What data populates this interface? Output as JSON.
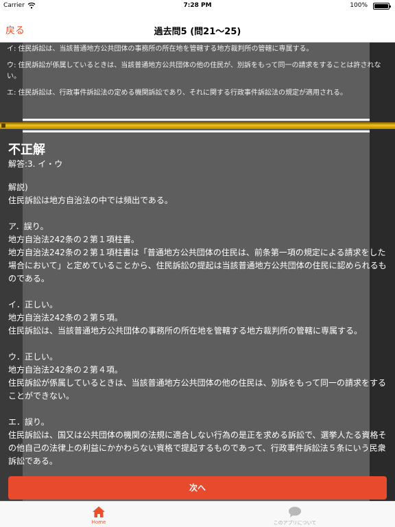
{
  "status": {
    "carrier": "Carrier",
    "time": "7:28 PM",
    "battery": "100%"
  },
  "nav": {
    "back": "戻る",
    "title": "過去問5 (問21〜25)"
  },
  "previous_choices": [
    "イ: 住民訴訟は、当該普通地方公共団体の事務所の所在地を管轄する地方裁判所の管轄に専属する。",
    "ウ: 住民訴訟が係属しているときは、当該普通地方公共団体の他の住民が、別訴をもって同一の請求をすることは許されない。",
    "エ: 住民訴訟は、行政事件訴訟法の定める機関訴訟であり、それに関する行政事件訴訟法の規定が適用される。"
  ],
  "result": {
    "status": "不正解",
    "answer": "解答:3. イ・ウ"
  },
  "explanation": [
    "解説)",
    "住民訴訟は地方自治法の中では頻出である。",
    "",
    "ア．誤り。",
    "地方自治法242条の２第１項柱書。",
    "地方自治法242条の２第１項柱書は「普通地方公共団体の住民は、前条第一項の規定による請求をした場合において」と定めていることから、住民訴訟の提起は当該普通地方公共団体の住民に認められるものである。",
    "",
    "イ．正しい。",
    "地方自治法242条の２第５項。",
    "住民訴訟は、当該普通地方公共団体の事務所の所在地を管轄する地方裁判所の管轄に専属する。",
    "",
    "ウ．正しい。",
    "地方自治法242条の２第４項。",
    "住民訴訟が係属しているときは、当該普通地方公共団体の他の住民は、別訴をもって同一の請求をすることができない。",
    "",
    "エ．誤り。",
    "住民訴訟は、国又は公共団体の機関の法規に適合しない行為の是正を求める訴訟で、選挙人たる資格その他自己の法律上の利益にかかわらない資格で提起するものであって、行政事件訴訟法５条にいう民衆訴訟である。"
  ],
  "next_button": "次へ",
  "tabs": {
    "home": "Home",
    "about": "このアプリについて"
  },
  "colors": {
    "accent": "#e8512a",
    "next_button": "#e84a2e",
    "gold_bar": "#f2c218"
  },
  "icons": [
    "wifi-icon",
    "battery-icon",
    "home-icon",
    "chat-bubble-icon"
  ]
}
